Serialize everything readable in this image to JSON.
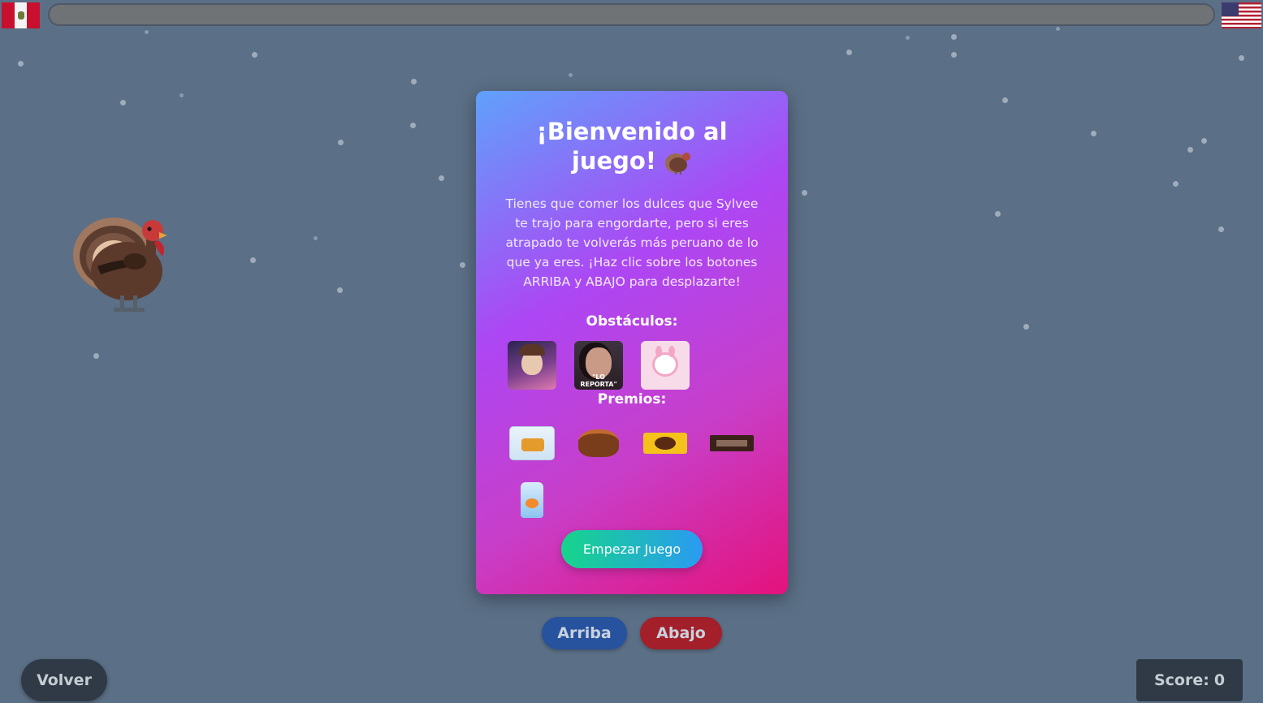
{
  "header": {
    "left_flag": "peru-flag",
    "right_flag": "usa-flag",
    "progress": 0
  },
  "modal": {
    "title": "¡Bienvenido al juego!",
    "title_icon": "turkey-icon",
    "description": "Tienes que comer los dulces que Sylvee te trajo para engordarte, pero si eres atrapado te volverás más peruano de lo que ya eres. ¡Haz clic sobre los botones ARRIBA y ABAJO para desplazarte!",
    "obstacles_title": "Obstáculos:",
    "obstacles": [
      {
        "name": "obstacle-1"
      },
      {
        "name": "obstacle-2",
        "caption": "\"LO REPORTA\""
      },
      {
        "name": "obstacle-3"
      }
    ],
    "prizes_title": "Premios:",
    "prizes": [
      {
        "name": "prize-1"
      },
      {
        "name": "prize-2"
      },
      {
        "name": "prize-3"
      },
      {
        "name": "prize-4"
      },
      {
        "name": "prize-5"
      }
    ],
    "start_label": "Empezar Juego"
  },
  "controls": {
    "up_label": "Arriba",
    "down_label": "Abajo"
  },
  "footer": {
    "back_label": "Volver",
    "score_label": "Score:",
    "score_value": "0"
  },
  "colors": {
    "background": "#5b6f86",
    "modal_gradient_start": "#60a1fb",
    "modal_gradient_end": "#e4127c",
    "up_button": "#26529e",
    "down_button": "#a31f2a",
    "start_gradient_start": "#16d58a",
    "start_gradient_end": "#2a9bf2"
  }
}
